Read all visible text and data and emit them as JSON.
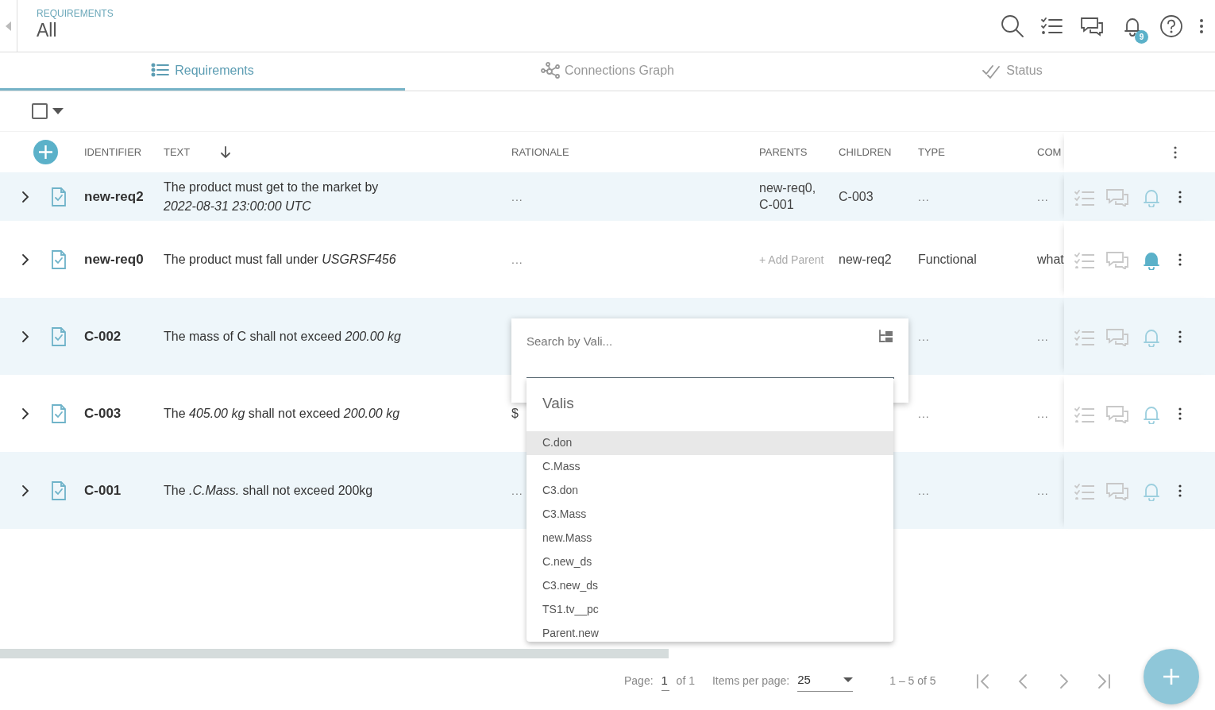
{
  "header": {
    "section": "REQUIREMENTS",
    "title": "All",
    "notification_count": "9"
  },
  "tabs": [
    {
      "label": "Requirements",
      "kind": "list",
      "selected": true
    },
    {
      "label": "Connections Graph",
      "kind": "graph",
      "selected": false
    },
    {
      "label": "Status",
      "kind": "status",
      "selected": false
    }
  ],
  "toolbar": {
    "select_all_checked": false
  },
  "table": {
    "columns": [
      "IDENTIFIER",
      "TEXT",
      "RATIONALE",
      "PARENTS",
      "CHILDREN",
      "TYPE",
      "COM"
    ],
    "rows": [
      {
        "identifier": "new-req2",
        "text": "The product must get to the market by *2022-08-31 23:00:00 UTC*",
        "rationale": "...",
        "parents": {
          "kind": "text",
          "text": "new-req0, C-001"
        },
        "children": "C-003",
        "type": "...",
        "comp": "...",
        "expanded": false,
        "subscribed": false
      },
      {
        "identifier": "new-req0",
        "text": "The product must fall under *USGRSF456*",
        "rationale": "...",
        "parents": {
          "kind": "link",
          "text": "+ Add Parent"
        },
        "children": "new-req2",
        "type": "Functional",
        "comp": "what",
        "expanded": false,
        "subscribed": true
      },
      {
        "identifier": "C-002",
        "text": "The mass of C shall not exceed *200.00 kg*",
        "type": "...",
        "comp": "...",
        "expanded": false,
        "subscribed": false
      },
      {
        "identifier": "C-003",
        "text": "The *405.00 kg* shall not exceed *200.00 kg*",
        "rationale": "$",
        "type": "...",
        "comp": "...",
        "expanded": false,
        "subscribed": false
      },
      {
        "identifier": "C-001",
        "text": "The *.C.Mass.* shall not exceed 200kg",
        "rationale": "...",
        "type": "...",
        "comp": "...",
        "expanded": false,
        "subscribed": false
      }
    ]
  },
  "popup": {
    "placeholder": "Search by Vali...",
    "list_heading": "Valis",
    "items": [
      {
        "label": "C.don",
        "selected": true
      },
      {
        "label": "C.Mass",
        "selected": false
      },
      {
        "label": "C3.don",
        "selected": false
      },
      {
        "label": "C3.Mass",
        "selected": false
      },
      {
        "label": "new.Mass",
        "selected": false
      },
      {
        "label": "C.new_ds",
        "selected": false
      },
      {
        "label": "C3.new_ds",
        "selected": false
      },
      {
        "label": "TS1.tv__pc",
        "selected": false
      },
      {
        "label": "Parent.new",
        "selected": false
      }
    ]
  },
  "paginator": {
    "page_label": "Page:",
    "page": "1",
    "page_total": "of 1",
    "items_label": "Items per page:",
    "items_per_page": "25",
    "range": "1 – 5 of 5"
  }
}
